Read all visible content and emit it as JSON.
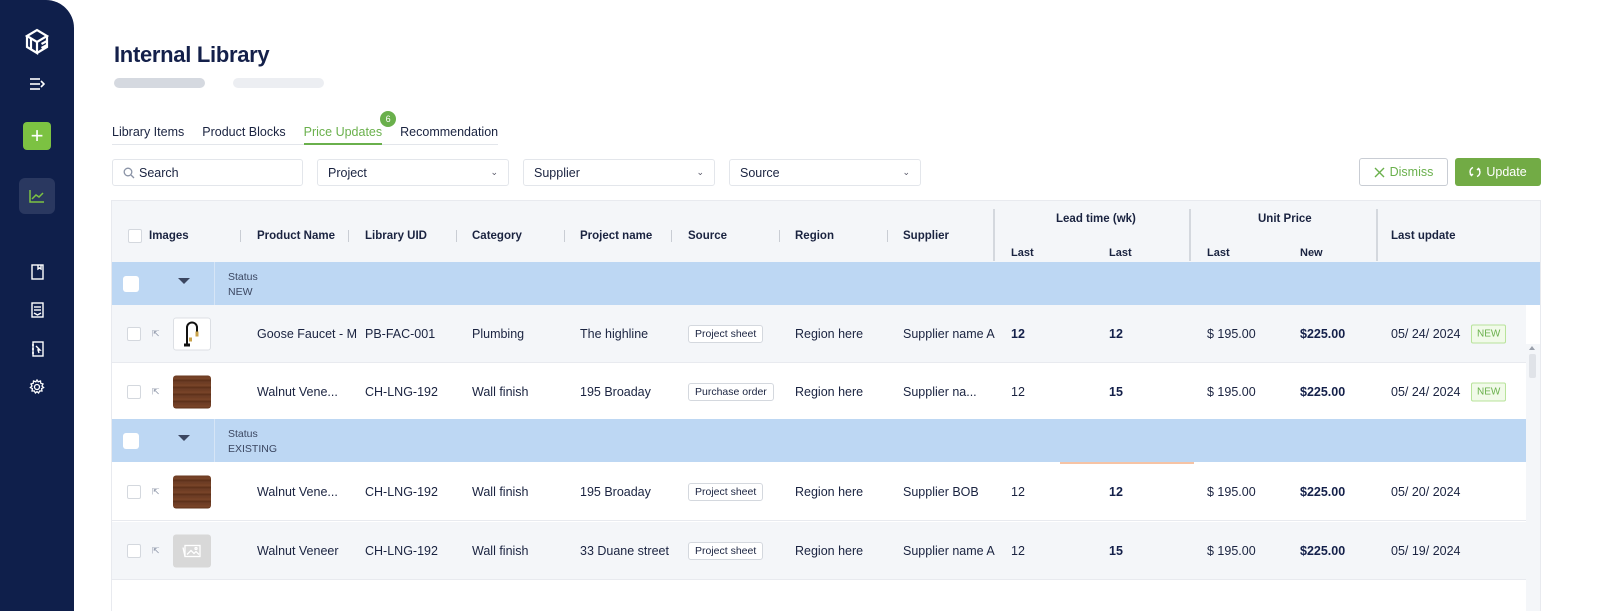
{
  "app": {
    "title": "Internal Library"
  },
  "sidebar": {
    "items": [
      {
        "icon": "logo-icon"
      },
      {
        "icon": "collapse-menu-icon"
      },
      {
        "icon": "add-icon",
        "label": "+"
      },
      {
        "icon": "chart-icon",
        "active": true
      },
      {
        "icon": "book-icon"
      },
      {
        "icon": "document-list-icon"
      },
      {
        "icon": "contacts-icon"
      },
      {
        "icon": "gear-icon"
      }
    ],
    "add_label": "+"
  },
  "tabs": [
    {
      "label": "Library Items",
      "active": false
    },
    {
      "label": "Product Blocks",
      "active": false
    },
    {
      "label": "Price Updates",
      "active": true,
      "badge": "6"
    },
    {
      "label": "Recommendation",
      "active": false
    }
  ],
  "filters": {
    "search_placeholder": "Search",
    "project": "Project",
    "supplier": "Supplier",
    "source": "Source"
  },
  "actions": {
    "dismiss": "Dismiss",
    "update": "Update"
  },
  "colors": {
    "sidebar": "#0f1f4b",
    "accent": "#6ab04c",
    "group_row": "#bdd7f3"
  },
  "table": {
    "headers": {
      "images": "Images",
      "product_name": "Product Name",
      "library_uid": "Library UID",
      "category": "Category",
      "project_name": "Project name",
      "source": "Source",
      "region": "Region",
      "supplier": "Supplier",
      "lead_time": "Lead time (wk)",
      "lead_last": "Last",
      "lead_new": "Last",
      "unit_price": "Unit Price",
      "price_last": "Last",
      "price_new": "New",
      "last_update": "Last update"
    },
    "groups": [
      {
        "label": "Status",
        "value": "NEW",
        "rows": [
          {
            "image": "faucet",
            "product_name": "Goose Faucet - M",
            "uid": "PB-FAC-001",
            "category": "Plumbing",
            "project": "The highline",
            "source": "Project sheet",
            "region": "Region here",
            "supplier": "Supplier name A",
            "lead_last": "12",
            "lead_new": "12",
            "price_last": "$ 195.00",
            "price_new": "$225.00",
            "last_update": "05/ 24/ 2024",
            "badge": "NEW"
          },
          {
            "image": "walnut",
            "product_name": "Walnut Vene...",
            "uid": "CH-LNG-192",
            "category": "Wall finish",
            "project": "195 Broaday",
            "source": "Purchase order",
            "region": "Region here",
            "supplier": "Supplier na...",
            "lead_last": "12",
            "lead_new": "15",
            "price_last": "$ 195.00",
            "price_new": "$225.00",
            "last_update": "05/ 24/ 2024",
            "badge": "NEW"
          }
        ]
      },
      {
        "label": "Status",
        "value": "EXISTING",
        "rows": [
          {
            "image": "walnut",
            "product_name": "Walnut Vene...",
            "uid": "CH-LNG-192",
            "category": "Wall finish",
            "project": "195 Broaday",
            "source": "Project sheet",
            "region": "Region here",
            "supplier": "Supplier BOB",
            "lead_last": "12",
            "lead_new": "12",
            "price_last": "$ 195.00",
            "price_new": "$225.00",
            "last_update": "05/ 20/ 2024"
          },
          {
            "image": "placeholder",
            "product_name": "Walnut Veneer",
            "uid": "CH-LNG-192",
            "category": "Wall finish",
            "project": "33 Duane street",
            "source": "Project sheet",
            "region": "Region here",
            "supplier": "Supplier name A",
            "lead_last": "12",
            "lead_new": "15",
            "price_last": "$ 195.00",
            "price_new": "$225.00",
            "last_update": "05/ 19/ 2024"
          }
        ]
      }
    ]
  }
}
